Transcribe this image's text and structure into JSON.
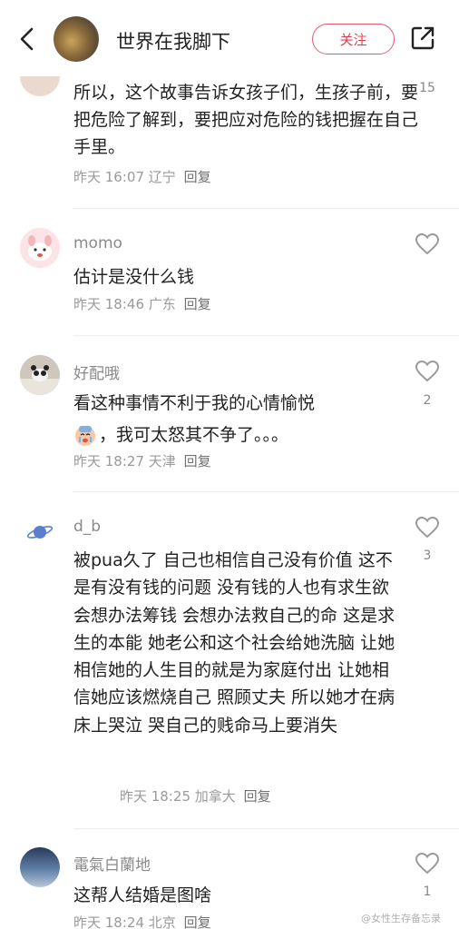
{
  "header": {
    "title": "世界在我脚下",
    "follow_label": "关注"
  },
  "comments": [
    {
      "text": "所以，这个故事告诉女孩子们，生孩子前，要把危险了解到，要把应对危险的钱把握在自己手里。",
      "time": "昨天 16:07",
      "location": "辽宁",
      "reply": "回复",
      "likes": "15"
    },
    {
      "name": "momo",
      "text": "估计是没什么钱",
      "time": "昨天 18:46",
      "location": "广东",
      "reply": "回复"
    },
    {
      "name": "好配哦",
      "text_line1": "看这种事情不利于我的心情愉悦",
      "text_line2": "，我可太怒其不争了。。。",
      "time": "昨天 18:27",
      "location": "天津",
      "reply": "回复",
      "likes": "2"
    },
    {
      "name": "d_b",
      "text": "被pua久了 自己也相信自己没有价值 这不是有没有钱的问题 没有钱的人也有求生欲 会想办法筹钱 会想办法救自己的命 这是求生的本能 她老公和这个社会给她洗脑 让她相信她的人生目的就是为家庭付出 让她相信她应该燃烧自己 照顾丈夫 所以她才在病床上哭泣 哭自己的贱命马上要消失",
      "time": "昨天 18:25",
      "location": "加拿大",
      "reply": "回复",
      "likes": "3"
    },
    {
      "name": "電氣白蘭地",
      "text": "这帮人结婚是图啥",
      "time": "昨天 18:24",
      "location": "北京",
      "reply": "回复",
      "likes": "1"
    }
  ],
  "watermark": "@女性生存备忘录",
  "colors": {
    "accent": "#e04050",
    "meta": "#9a9a9a",
    "name": "#8a8a8a"
  }
}
